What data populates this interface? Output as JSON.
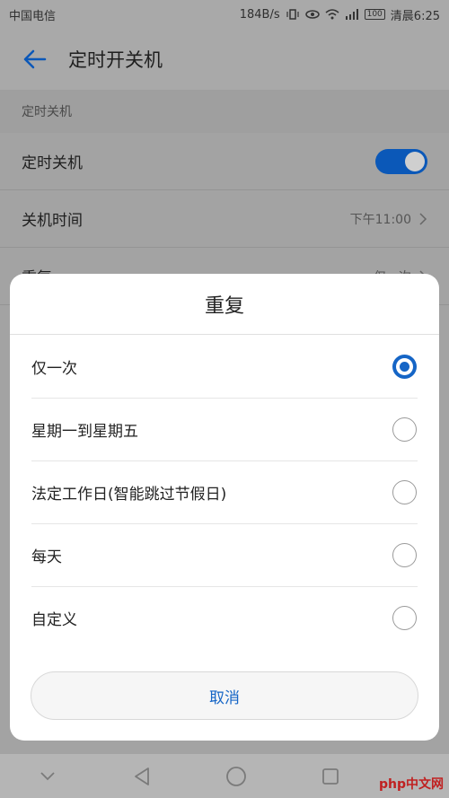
{
  "status_bar": {
    "carrier": "中国电信",
    "speed": "184B/s",
    "battery": "100",
    "time": "清晨6:25"
  },
  "app_bar": {
    "title": "定时开关机"
  },
  "settings": {
    "section_header": "定时关机",
    "rows": [
      {
        "label": "定时关机",
        "toggle_on": true
      },
      {
        "label": "关机时间",
        "value": "下午11:00"
      },
      {
        "label": "重复",
        "value": "仅一次"
      }
    ]
  },
  "dialog": {
    "title": "重复",
    "options": [
      {
        "label": "仅一次",
        "selected": true
      },
      {
        "label": "星期一到星期五",
        "selected": false
      },
      {
        "label": "法定工作日(智能跳过节假日)",
        "selected": false
      },
      {
        "label": "每天",
        "selected": false
      },
      {
        "label": "自定义",
        "selected": false
      }
    ],
    "cancel_label": "取消"
  },
  "nav_bar": {
    "icons": [
      "chevron-down-icon",
      "back-triangle-icon",
      "home-circle-icon",
      "recents-square-icon"
    ]
  },
  "watermark": "php中文网",
  "colors": {
    "accent": "#1565c6",
    "toggle_on": "#0b58b8",
    "scrim": "#a3a3a3"
  }
}
